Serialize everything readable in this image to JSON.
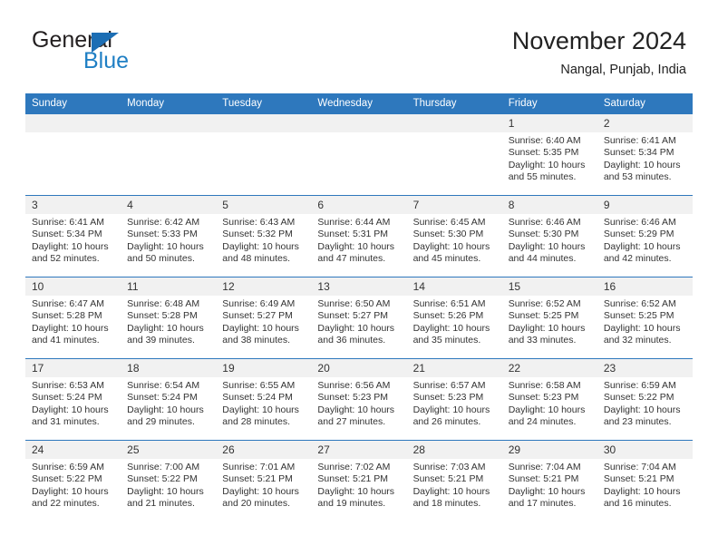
{
  "brand": {
    "name_part1": "General",
    "name_part2": "Blue",
    "triangle_color": "#1c6eb4",
    "blue_text_color": "#1f7fc4"
  },
  "header": {
    "title": "November 2024",
    "location": "Nangal, Punjab, India"
  },
  "theme": {
    "header_row_bg": "#2e78bd",
    "header_row_text": "#ffffff",
    "day_number_bg": "#f1f1f1",
    "cell_border": "#2e78bd",
    "body_text": "#333333"
  },
  "weekdays": [
    "Sunday",
    "Monday",
    "Tuesday",
    "Wednesday",
    "Thursday",
    "Friday",
    "Saturday"
  ],
  "labels": {
    "sunrise_prefix": "Sunrise:",
    "sunset_prefix": "Sunset:",
    "daylight_prefix": "Daylight:"
  },
  "weeks": [
    [
      {
        "day": "",
        "empty": true
      },
      {
        "day": "",
        "empty": true
      },
      {
        "day": "",
        "empty": true
      },
      {
        "day": "",
        "empty": true
      },
      {
        "day": "",
        "empty": true
      },
      {
        "day": "1",
        "sunrise": "Sunrise: 6:40 AM",
        "sunset": "Sunset: 5:35 PM",
        "daylight": "Daylight: 10 hours and 55 minutes."
      },
      {
        "day": "2",
        "sunrise": "Sunrise: 6:41 AM",
        "sunset": "Sunset: 5:34 PM",
        "daylight": "Daylight: 10 hours and 53 minutes."
      }
    ],
    [
      {
        "day": "3",
        "sunrise": "Sunrise: 6:41 AM",
        "sunset": "Sunset: 5:34 PM",
        "daylight": "Daylight: 10 hours and 52 minutes."
      },
      {
        "day": "4",
        "sunrise": "Sunrise: 6:42 AM",
        "sunset": "Sunset: 5:33 PM",
        "daylight": "Daylight: 10 hours and 50 minutes."
      },
      {
        "day": "5",
        "sunrise": "Sunrise: 6:43 AM",
        "sunset": "Sunset: 5:32 PM",
        "daylight": "Daylight: 10 hours and 48 minutes."
      },
      {
        "day": "6",
        "sunrise": "Sunrise: 6:44 AM",
        "sunset": "Sunset: 5:31 PM",
        "daylight": "Daylight: 10 hours and 47 minutes."
      },
      {
        "day": "7",
        "sunrise": "Sunrise: 6:45 AM",
        "sunset": "Sunset: 5:30 PM",
        "daylight": "Daylight: 10 hours and 45 minutes."
      },
      {
        "day": "8",
        "sunrise": "Sunrise: 6:46 AM",
        "sunset": "Sunset: 5:30 PM",
        "daylight": "Daylight: 10 hours and 44 minutes."
      },
      {
        "day": "9",
        "sunrise": "Sunrise: 6:46 AM",
        "sunset": "Sunset: 5:29 PM",
        "daylight": "Daylight: 10 hours and 42 minutes."
      }
    ],
    [
      {
        "day": "10",
        "sunrise": "Sunrise: 6:47 AM",
        "sunset": "Sunset: 5:28 PM",
        "daylight": "Daylight: 10 hours and 41 minutes."
      },
      {
        "day": "11",
        "sunrise": "Sunrise: 6:48 AM",
        "sunset": "Sunset: 5:28 PM",
        "daylight": "Daylight: 10 hours and 39 minutes."
      },
      {
        "day": "12",
        "sunrise": "Sunrise: 6:49 AM",
        "sunset": "Sunset: 5:27 PM",
        "daylight": "Daylight: 10 hours and 38 minutes."
      },
      {
        "day": "13",
        "sunrise": "Sunrise: 6:50 AM",
        "sunset": "Sunset: 5:27 PM",
        "daylight": "Daylight: 10 hours and 36 minutes."
      },
      {
        "day": "14",
        "sunrise": "Sunrise: 6:51 AM",
        "sunset": "Sunset: 5:26 PM",
        "daylight": "Daylight: 10 hours and 35 minutes."
      },
      {
        "day": "15",
        "sunrise": "Sunrise: 6:52 AM",
        "sunset": "Sunset: 5:25 PM",
        "daylight": "Daylight: 10 hours and 33 minutes."
      },
      {
        "day": "16",
        "sunrise": "Sunrise: 6:52 AM",
        "sunset": "Sunset: 5:25 PM",
        "daylight": "Daylight: 10 hours and 32 minutes."
      }
    ],
    [
      {
        "day": "17",
        "sunrise": "Sunrise: 6:53 AM",
        "sunset": "Sunset: 5:24 PM",
        "daylight": "Daylight: 10 hours and 31 minutes."
      },
      {
        "day": "18",
        "sunrise": "Sunrise: 6:54 AM",
        "sunset": "Sunset: 5:24 PM",
        "daylight": "Daylight: 10 hours and 29 minutes."
      },
      {
        "day": "19",
        "sunrise": "Sunrise: 6:55 AM",
        "sunset": "Sunset: 5:24 PM",
        "daylight": "Daylight: 10 hours and 28 minutes."
      },
      {
        "day": "20",
        "sunrise": "Sunrise: 6:56 AM",
        "sunset": "Sunset: 5:23 PM",
        "daylight": "Daylight: 10 hours and 27 minutes."
      },
      {
        "day": "21",
        "sunrise": "Sunrise: 6:57 AM",
        "sunset": "Sunset: 5:23 PM",
        "daylight": "Daylight: 10 hours and 26 minutes."
      },
      {
        "day": "22",
        "sunrise": "Sunrise: 6:58 AM",
        "sunset": "Sunset: 5:23 PM",
        "daylight": "Daylight: 10 hours and 24 minutes."
      },
      {
        "day": "23",
        "sunrise": "Sunrise: 6:59 AM",
        "sunset": "Sunset: 5:22 PM",
        "daylight": "Daylight: 10 hours and 23 minutes."
      }
    ],
    [
      {
        "day": "24",
        "sunrise": "Sunrise: 6:59 AM",
        "sunset": "Sunset: 5:22 PM",
        "daylight": "Daylight: 10 hours and 22 minutes."
      },
      {
        "day": "25",
        "sunrise": "Sunrise: 7:00 AM",
        "sunset": "Sunset: 5:22 PM",
        "daylight": "Daylight: 10 hours and 21 minutes."
      },
      {
        "day": "26",
        "sunrise": "Sunrise: 7:01 AM",
        "sunset": "Sunset: 5:21 PM",
        "daylight": "Daylight: 10 hours and 20 minutes."
      },
      {
        "day": "27",
        "sunrise": "Sunrise: 7:02 AM",
        "sunset": "Sunset: 5:21 PM",
        "daylight": "Daylight: 10 hours and 19 minutes."
      },
      {
        "day": "28",
        "sunrise": "Sunrise: 7:03 AM",
        "sunset": "Sunset: 5:21 PM",
        "daylight": "Daylight: 10 hours and 18 minutes."
      },
      {
        "day": "29",
        "sunrise": "Sunrise: 7:04 AM",
        "sunset": "Sunset: 5:21 PM",
        "daylight": "Daylight: 10 hours and 17 minutes."
      },
      {
        "day": "30",
        "sunrise": "Sunrise: 7:04 AM",
        "sunset": "Sunset: 5:21 PM",
        "daylight": "Daylight: 10 hours and 16 minutes."
      }
    ]
  ]
}
